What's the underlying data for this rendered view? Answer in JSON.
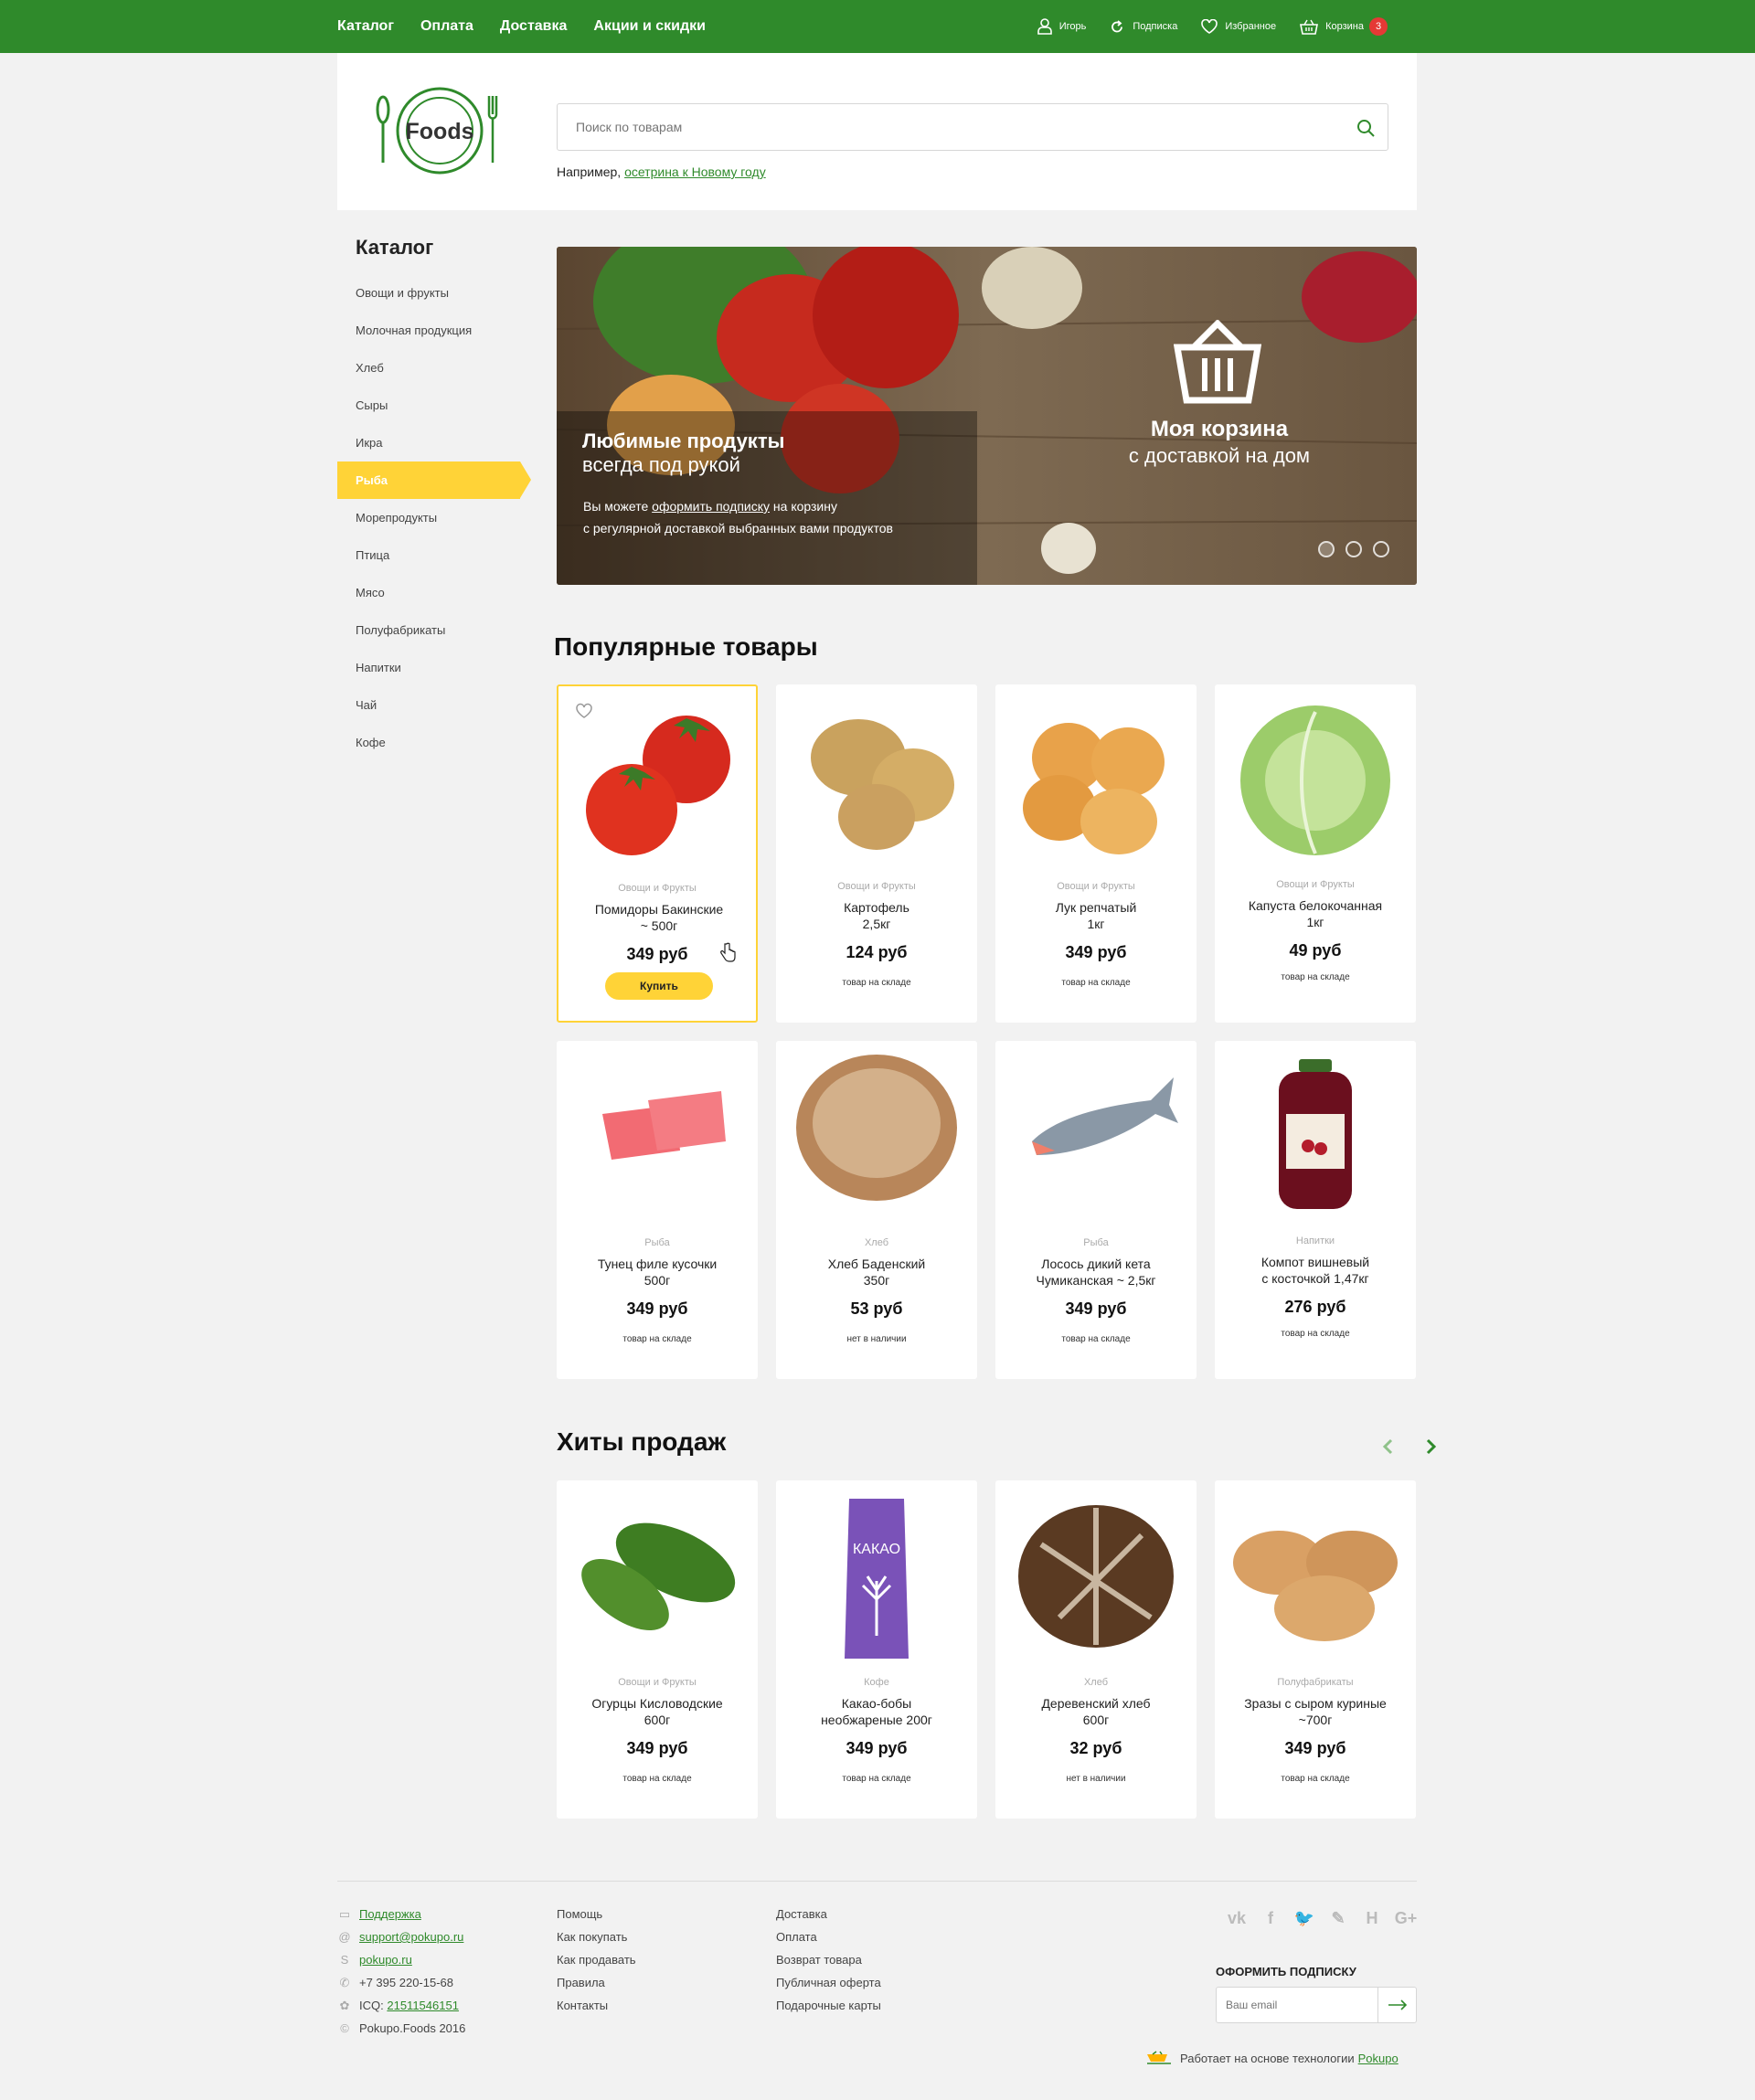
{
  "topnav": {
    "items": [
      "Каталог",
      "Оплата",
      "Доставка",
      "Акции и скидки"
    ],
    "user": "Игорь",
    "subscription": "Подписка",
    "favorites": "Избранное",
    "cart": "Корзина",
    "cart_count": "3"
  },
  "header": {
    "logo_text": "Foods",
    "search_placeholder": "Поиск по товарам",
    "example_prefix": "Например,",
    "example_link": "осетрина к Новому году"
  },
  "sidebar": {
    "title": "Каталог",
    "items": [
      "Овощи и фрукты",
      "Молочная продукция",
      "Хлеб",
      "Сыры",
      "Икра",
      "Рыба",
      "Морепродукты",
      "Птица",
      "Мясо",
      "Полуфабрикаты",
      "Напитки",
      "Чай",
      "Кофе"
    ],
    "active": "Рыба"
  },
  "banner": {
    "title": "Любимые продукты",
    "subtitle": "всегда под рукой",
    "text_before": "Вы можете",
    "text_link": "оформить подписку",
    "text_after": "на корзину",
    "text_line2": "с регулярной доставкой выбранных вами продуктов",
    "basket_title": "Моя корзина",
    "basket_subtitle": "с доставкой на дом",
    "slides": 3,
    "active_slide": 1
  },
  "popular": {
    "title": "Популярные товары",
    "buy_label": "Купить",
    "items": [
      {
        "category": "Овощи и Фрукты",
        "name1": "Помидоры Бакинские",
        "name2": "~ 500г",
        "price": "349 руб",
        "stock": "",
        "img": "tomato"
      },
      {
        "category": "Овощи и Фрукты",
        "name1": "Картофель",
        "name2": "2,5кг",
        "price": "124 руб",
        "stock": "товар на складе",
        "img": "potato"
      },
      {
        "category": "Овощи и Фрукты",
        "name1": "Лук репчатый",
        "name2": "1кг",
        "price": "349 руб",
        "stock": "товар на складе",
        "img": "onion"
      },
      {
        "category": "Овощи и Фрукты",
        "name1": "Капуста белокочанная",
        "name2": "1кг",
        "price": "49 руб",
        "stock": "товар на складе",
        "img": "cabbage"
      },
      {
        "category": "Рыба",
        "name1": "Тунец филе кусочки",
        "name2": "500г",
        "price": "349 руб",
        "stock": "товар на складе",
        "img": "tuna"
      },
      {
        "category": "Хлеб",
        "name1": "Хлеб Баденский",
        "name2": "350г",
        "price": "53 руб",
        "stock": "нет в наличии",
        "img": "bread"
      },
      {
        "category": "Рыба",
        "name1": "Лосось дикий кета",
        "name2": "Чумиканская ~ 2,5кг",
        "price": "349 руб",
        "stock": "товар на складе",
        "img": "fish"
      },
      {
        "category": "Напитки",
        "name1": "Компот вишневый",
        "name2": "с косточкой 1,47кг",
        "price": "276 руб",
        "stock": "товар на складе",
        "img": "jar"
      }
    ]
  },
  "hits": {
    "title": "Хиты продаж",
    "items": [
      {
        "category": "Овощи и Фрукты",
        "name1": "Огурцы Кисловодские",
        "name2": "600г",
        "price": "349 руб",
        "stock": "товар на складе",
        "img": "cucumber"
      },
      {
        "category": "Кофе",
        "name1": "Какао-бобы",
        "name2": "необжареные 200г",
        "price": "349 руб",
        "stock": "товар на складе",
        "img": "cocoa",
        "pack_label": "КАКАО"
      },
      {
        "category": "Хлеб",
        "name1": "Деревенский хлеб",
        "name2": "600г",
        "price": "32 руб",
        "stock": "нет в наличии",
        "img": "darkbread"
      },
      {
        "category": "Полуфабрикаты",
        "name1": "Зразы с сыром куриные",
        "name2": "~700г",
        "price": "349 руб",
        "stock": "товар на складе",
        "img": "cutlets"
      }
    ]
  },
  "footer": {
    "contacts": {
      "support": "Поддержка",
      "email": "support@pokupo.ru",
      "skype": "pokupo.ru",
      "phone": "+7 395 220-15-68",
      "icq_label": "ICQ:",
      "icq": "21511546151",
      "copyright": "Pokupo.Foods 2016"
    },
    "col2": [
      "Помощь",
      "Как покупать",
      "Как продавать",
      "Правила",
      "Контакты"
    ],
    "col3": [
      "Доставка",
      "Оплата",
      "Возврат товара",
      "Публичная оферта",
      "Подарочные карты"
    ],
    "social": [
      "vk",
      "f",
      "twitter",
      "odnoklassniki",
      "H",
      "G+"
    ],
    "subscribe_title": "ОФОРМИТЬ ПОДПИСКУ",
    "subscribe_placeholder": "Ваш email",
    "powered_text": "Работает на основе технологии",
    "powered_link": "Pokupo"
  },
  "colors": {
    "brand_green": "#2f8a2b",
    "accent_yellow": "#ffd337",
    "badge_red": "#e53935"
  }
}
